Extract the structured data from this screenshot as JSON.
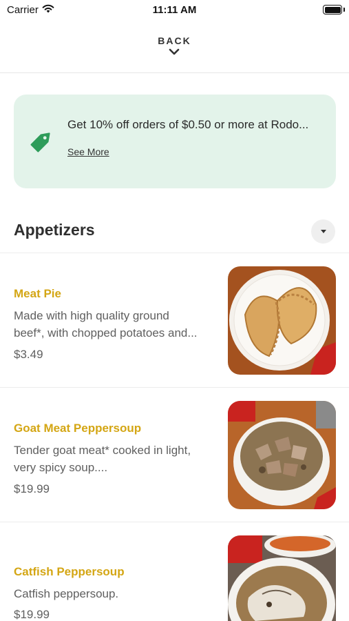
{
  "status_bar": {
    "carrier": "Carrier",
    "time": "11:11 AM"
  },
  "header": {
    "back_label": "BACK"
  },
  "promo": {
    "text": "Get 10% off orders of $0.50 or more at Rodo...",
    "link": "See More",
    "icon": "price-tag-icon"
  },
  "section": {
    "title": "Appetizers"
  },
  "items": [
    {
      "name": "Meat Pie",
      "desc1": "Made with high quality ground",
      "desc2": "beef*, with chopped potatoes and...",
      "price": "$3.49"
    },
    {
      "name": "Goat Meat Peppersoup",
      "desc1": "Tender goat meat* cooked in light,",
      "desc2": "very spicy soup....",
      "price": "$19.99"
    },
    {
      "name": "Catfish Peppersoup",
      "desc1": "Catfish peppersoup.",
      "desc2": "",
      "price": "$19.99"
    }
  ],
  "colors": {
    "accent": "#d4a614",
    "promo_bg": "#e3f3ea",
    "tag": "#2e9c5a"
  }
}
